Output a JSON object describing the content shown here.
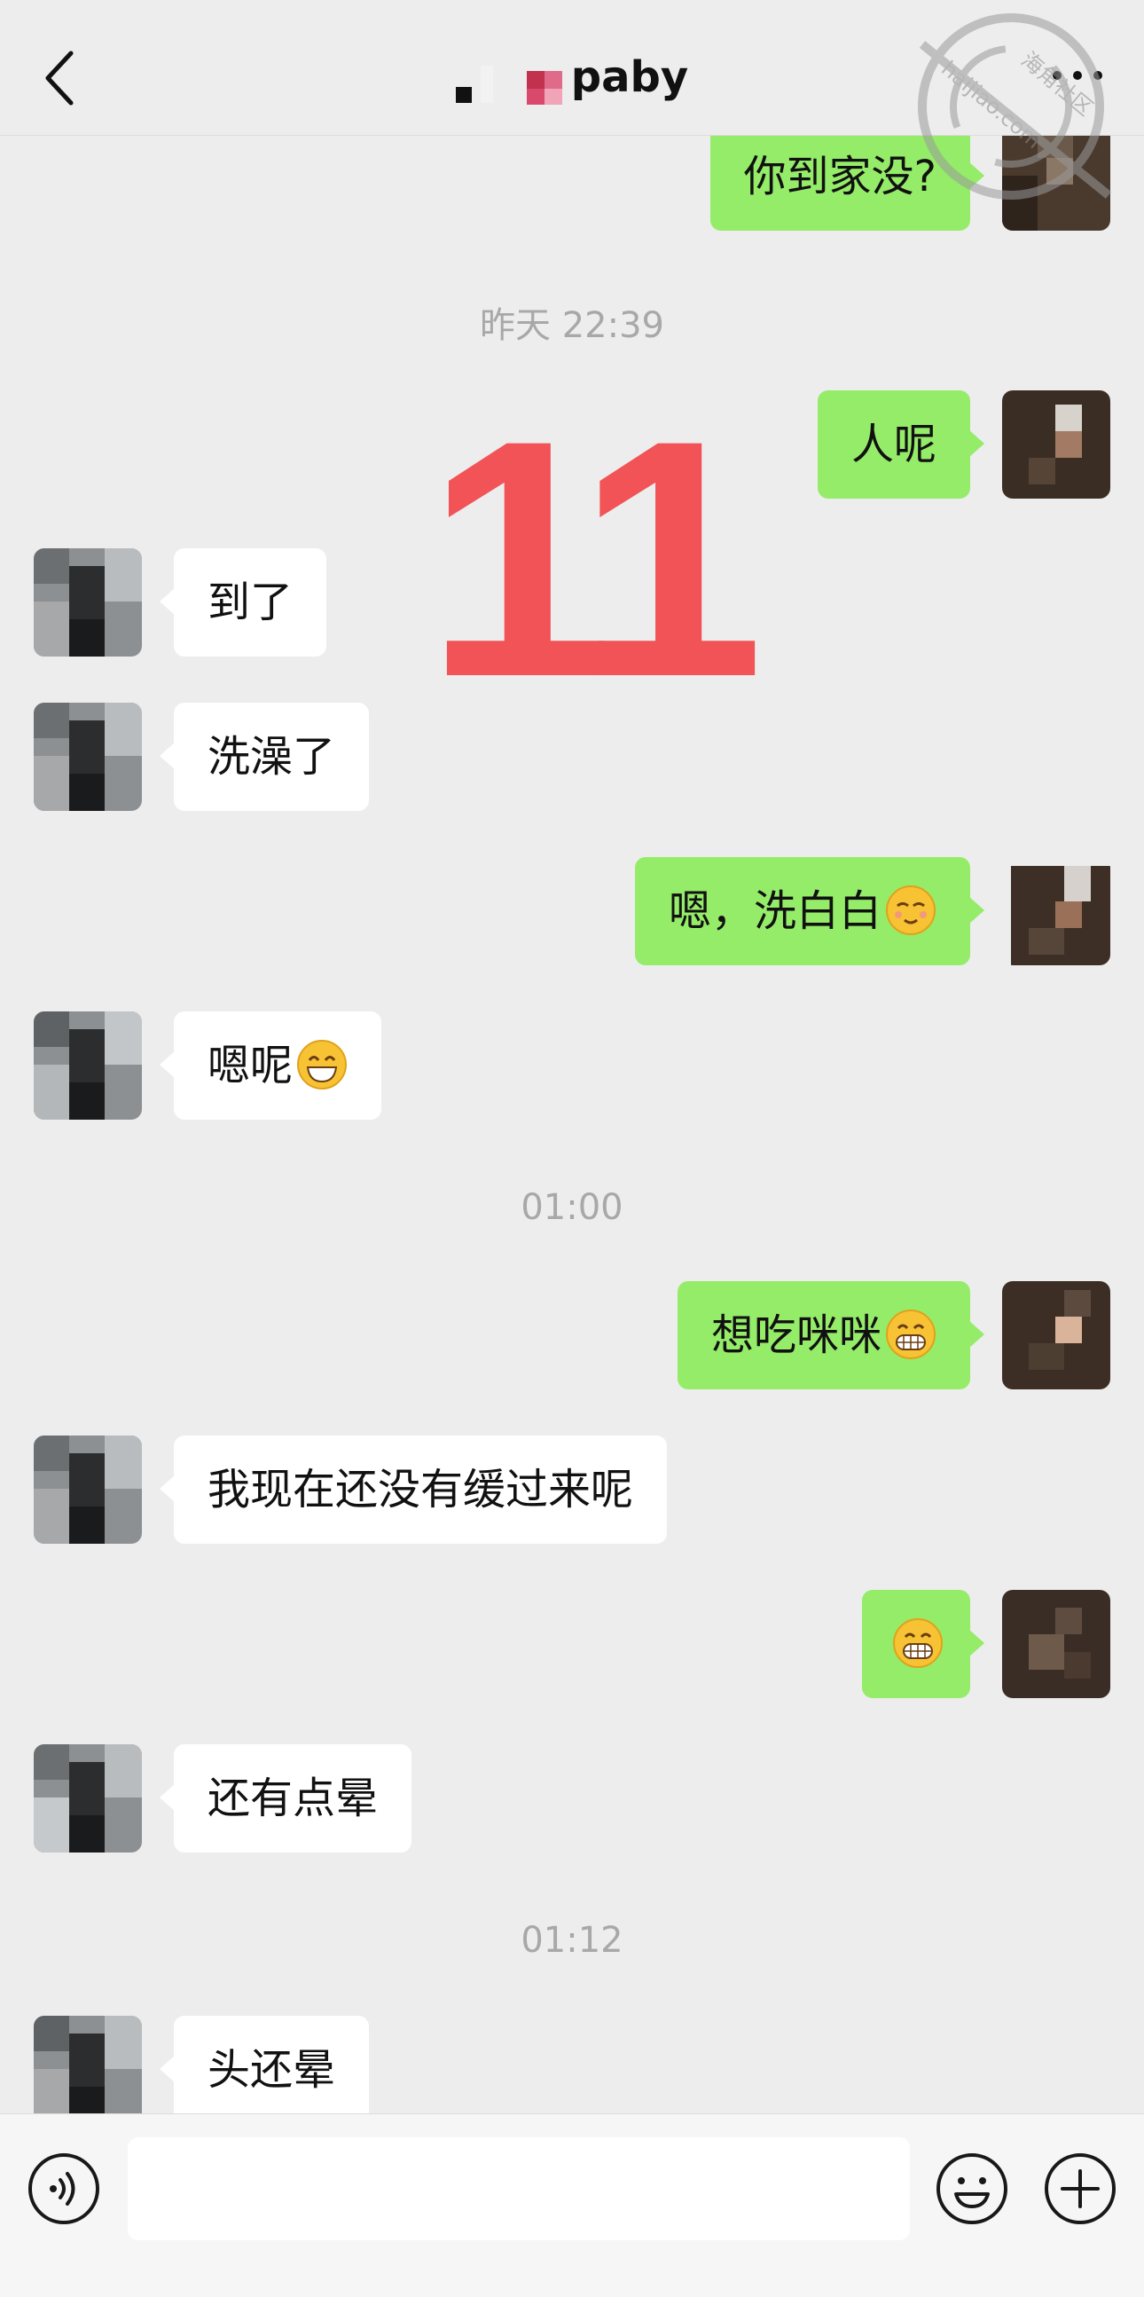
{
  "header": {
    "title": "paby"
  },
  "overlay_number": "11",
  "messages": [
    {
      "side": "me",
      "text": "你到家没?"
    },
    {
      "type": "time",
      "text": "昨天 22:39"
    },
    {
      "side": "me",
      "text": "人呢"
    },
    {
      "side": "them",
      "text": "到了"
    },
    {
      "side": "them",
      "text": "洗澡了"
    },
    {
      "side": "me",
      "text": "嗯，洗白白",
      "emoji": "relieved-face-icon"
    },
    {
      "side": "them",
      "text": "嗯呢",
      "emoji": "grinning-face-icon"
    },
    {
      "type": "time",
      "text": "01:00"
    },
    {
      "side": "me",
      "text": "想吃咪咪",
      "emoji": "beaming-face-icon"
    },
    {
      "side": "them",
      "text": "我现在还没有缓过来呢"
    },
    {
      "side": "me",
      "text": "",
      "emoji": "beaming-face-icon"
    },
    {
      "side": "them",
      "text": "还有点晕"
    },
    {
      "type": "time",
      "text": "01:12"
    },
    {
      "side": "them",
      "text": "头还晕"
    }
  ],
  "watermark": {
    "text1": "海角社区",
    "text2": "haijiao.com"
  },
  "colors": {
    "background": "#ededed",
    "my_bubble": "#95ec69",
    "their_bubble": "#ffffff",
    "overlay": "#f24b50"
  }
}
